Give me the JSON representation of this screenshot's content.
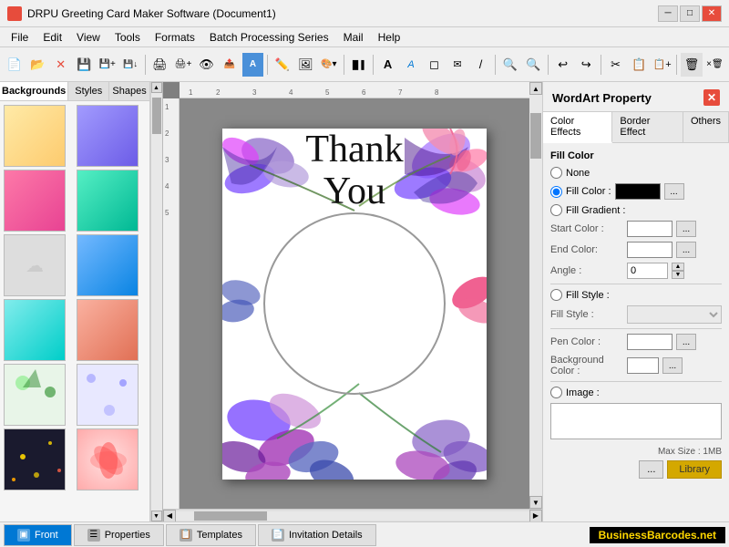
{
  "titlebar": {
    "title": "DRPU Greeting Card Maker Software (Document1)",
    "minimize": "─",
    "maximize": "□",
    "close": "✕"
  },
  "menubar": {
    "items": [
      "File",
      "Edit",
      "View",
      "Tools",
      "Formats",
      "Batch Processing Series",
      "Mail",
      "Help"
    ]
  },
  "lefttabs": {
    "tabs": [
      "Backgrounds",
      "Styles",
      "Shapes"
    ]
  },
  "wordart": {
    "panel_title": "WordArt Property",
    "close": "✕",
    "tabs": [
      "Color Effects",
      "Border Effect",
      "Others"
    ],
    "fill_color_section": "Fill Color",
    "none_label": "None",
    "fill_color_label": "Fill Color :",
    "fill_gradient_label": "Fill Gradient :",
    "start_color_label": "Start Color :",
    "end_color_label": "End Color:",
    "angle_label": "Angle :",
    "angle_value": "0",
    "fill_style_radio": "Fill Style :",
    "fill_style_label": "Fill Style :",
    "pen_color_label": "Pen Color :",
    "bg_color_label": "Background Color :",
    "image_label": "Image :",
    "max_size": "Max Size : 1MB",
    "library_btn": "Library",
    "dots_btn": "..."
  },
  "bottomtabs": {
    "tabs": [
      {
        "label": "Front",
        "active": true
      },
      {
        "label": "Properties",
        "active": false
      },
      {
        "label": "Templates",
        "active": false
      },
      {
        "label": "Invitation Details",
        "active": false
      }
    ]
  },
  "card": {
    "text_line1": "Thank",
    "text_line2": "You"
  },
  "watermark": "BusinessBarcodes.net"
}
